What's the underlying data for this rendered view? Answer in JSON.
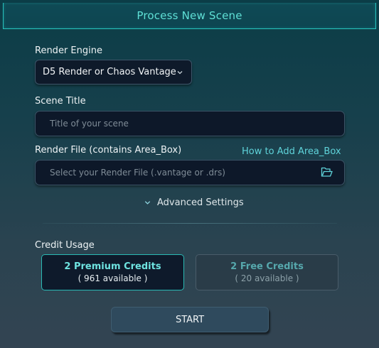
{
  "header": {
    "title": "Process New Scene"
  },
  "render_engine": {
    "label": "Render Engine",
    "selected": "D5 Render or Chaos Vantage"
  },
  "scene_title": {
    "label": "Scene Title",
    "placeholder": "Title of your scene",
    "value": ""
  },
  "render_file": {
    "label": "Render File  (contains Area_Box)",
    "help_link": "How to Add Area_Box",
    "placeholder": "Select your Render File (.vantage or .drs)"
  },
  "advanced_settings": {
    "label": "Advanced Settings"
  },
  "credit_usage": {
    "label": "Credit Usage",
    "options": [
      {
        "title": "2 Premium Credits",
        "subtitle": "( 961 available )",
        "selected": true
      },
      {
        "title": "2 Free Credits",
        "subtitle": "( 20 available )",
        "selected": false
      }
    ]
  },
  "start_button": {
    "label": "START"
  },
  "colors": {
    "accent": "#27c3bd",
    "link": "#5fd3da",
    "input_bg": "#0d1829"
  },
  "icons": [
    "chevron-down-icon",
    "folder-open-icon",
    "chevron-down-icon"
  ]
}
